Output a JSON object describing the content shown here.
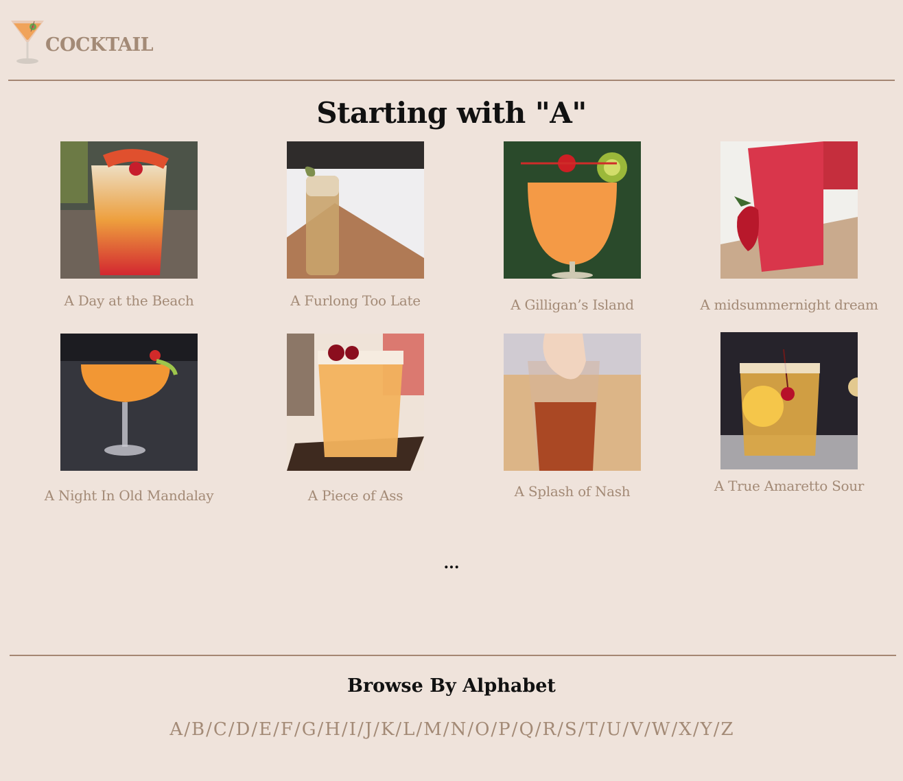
{
  "header": {
    "brand": "COCKTAIL"
  },
  "page_title": "Starting with \"A\"",
  "drinks": [
    {
      "name": "A Day at the Beach",
      "image": "cocktail-photo"
    },
    {
      "name": "A Furlong Too Late",
      "image": "cocktail-photo"
    },
    {
      "name": "A Gilligan’s Island",
      "image": "cocktail-photo"
    },
    {
      "name": "A midsummernight dream",
      "image": "cocktail-photo"
    },
    {
      "name": "A Night In Old Mandalay",
      "image": "cocktail-photo"
    },
    {
      "name": "A Piece of Ass",
      "image": "cocktail-photo"
    },
    {
      "name": "A Splash of Nash",
      "image": "cocktail-photo"
    },
    {
      "name": "A True Amaretto Sour",
      "image": "cocktail-photo"
    }
  ],
  "ellipsis": "...",
  "browse": {
    "title": "Browse By Alphabet",
    "letters": [
      "A",
      "B",
      "C",
      "D",
      "E",
      "F",
      "G",
      "H",
      "I",
      "J",
      "K",
      "L",
      "M",
      "N",
      "O",
      "P",
      "Q",
      "R",
      "S",
      "T",
      "U",
      "V",
      "W",
      "X",
      "Y",
      "Z"
    ],
    "separator": "/"
  },
  "colors": {
    "background": "#efe3db",
    "accent": "#a38a76",
    "rule": "#a48672"
  }
}
